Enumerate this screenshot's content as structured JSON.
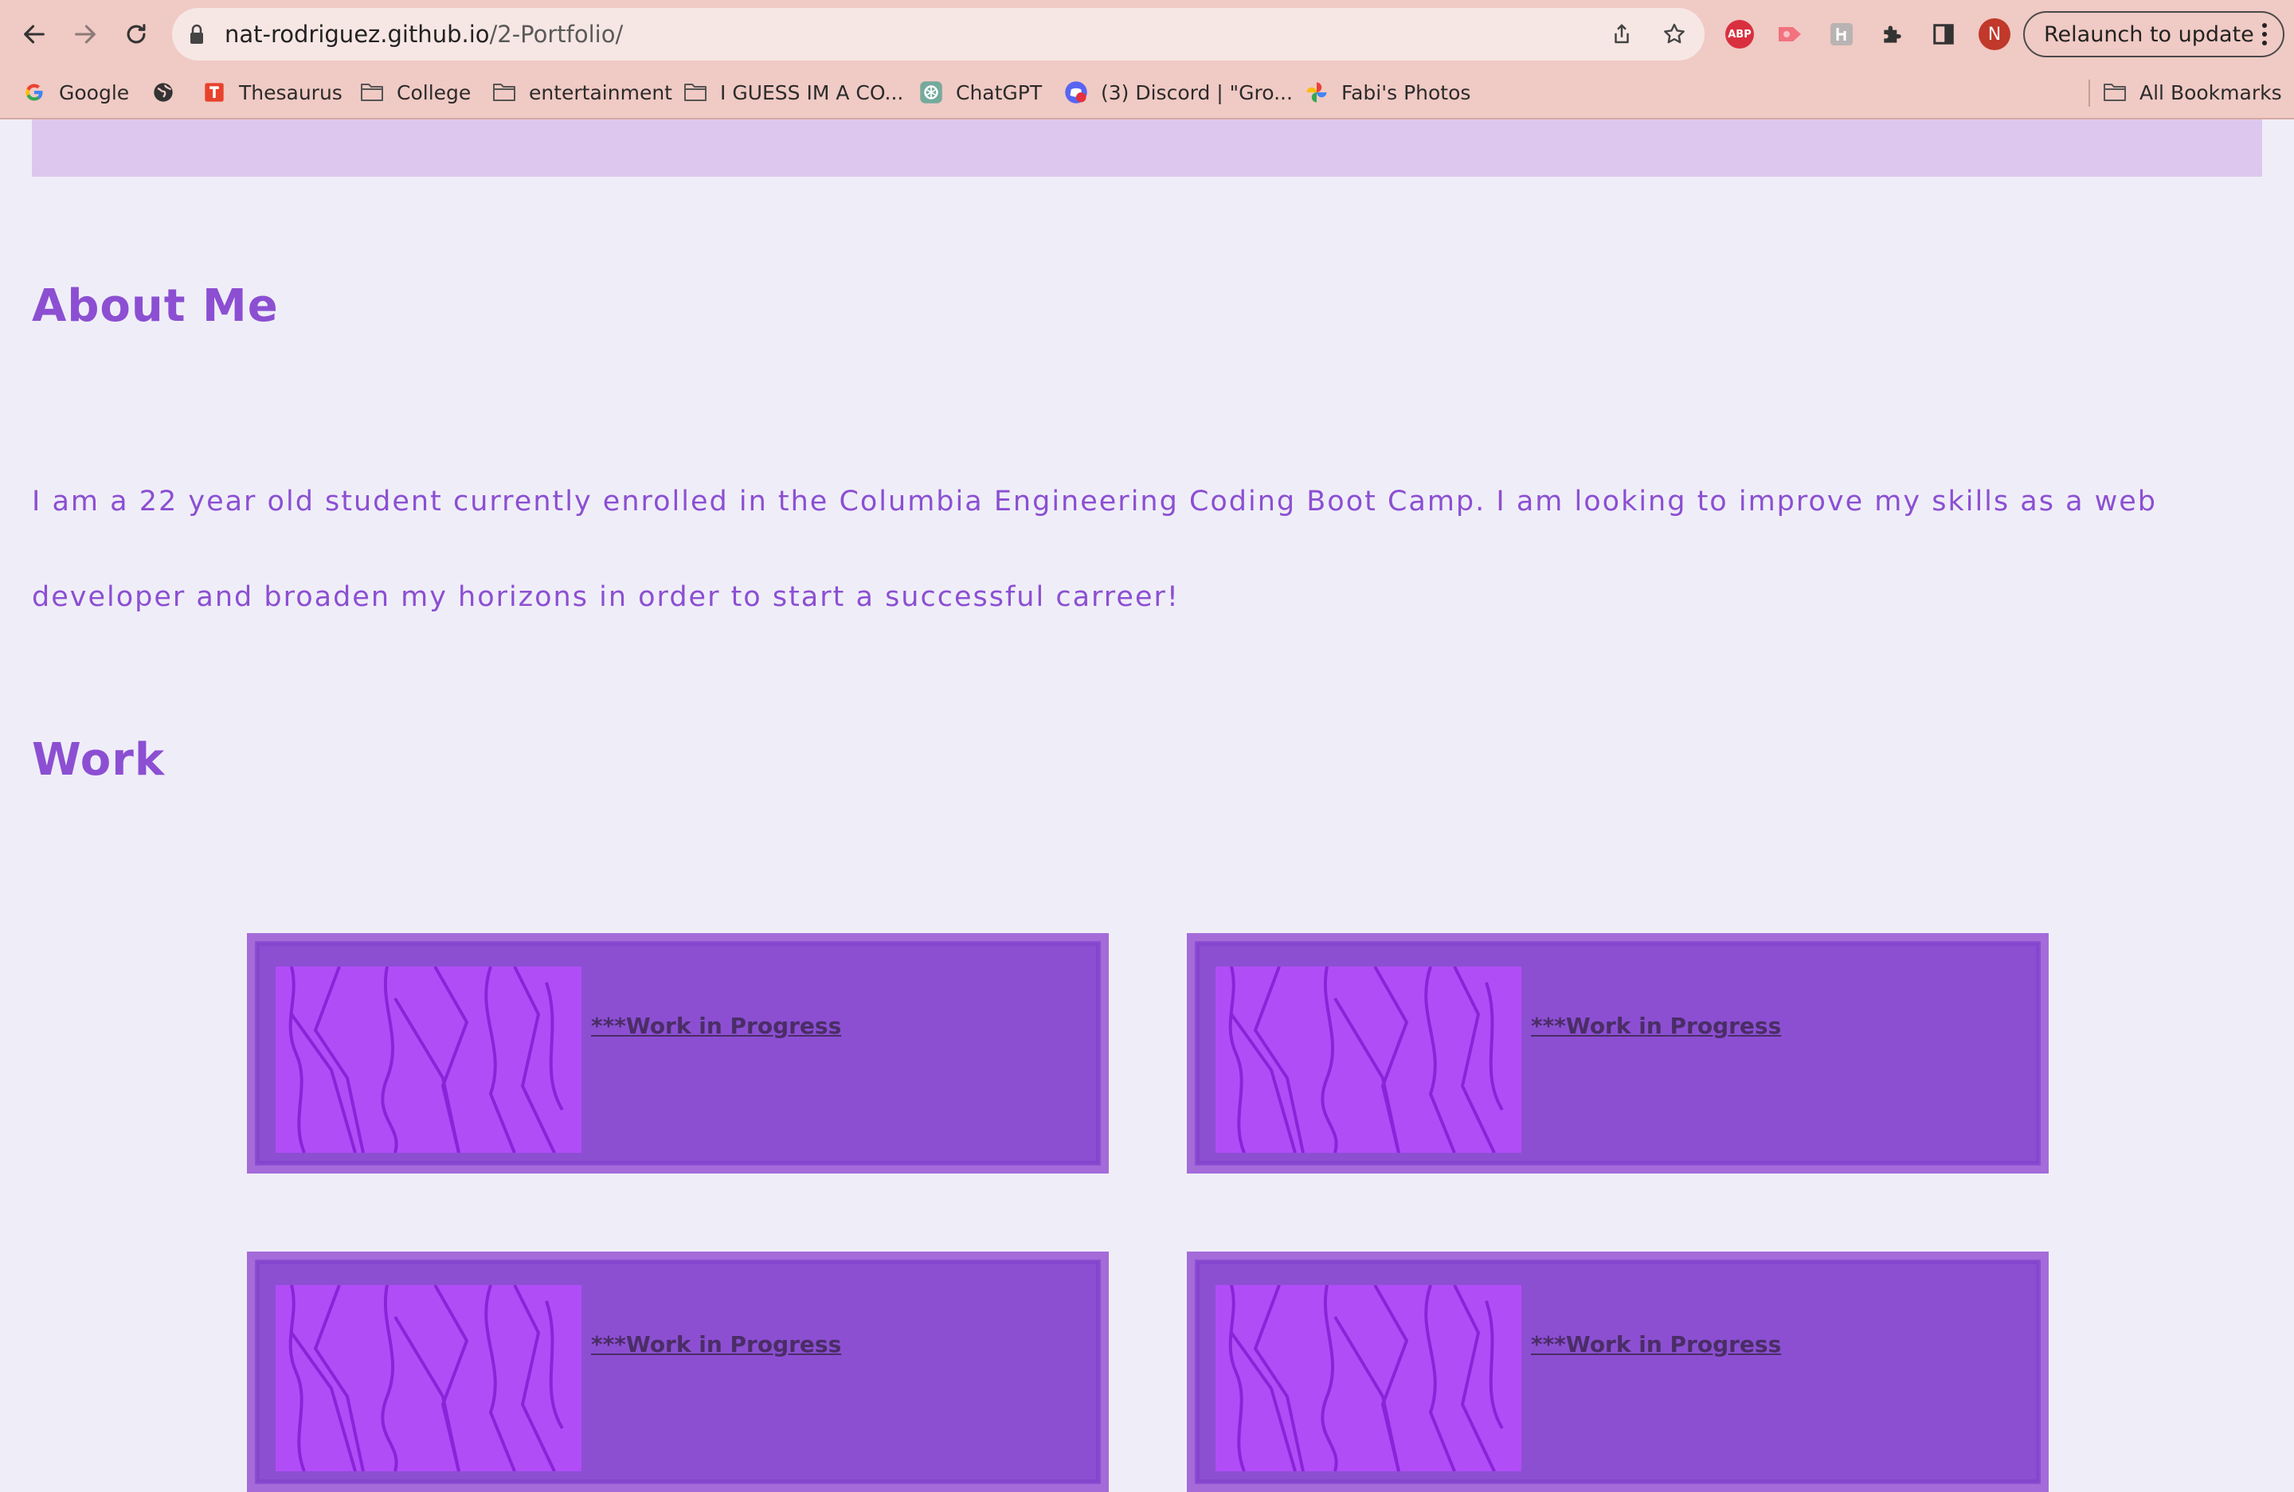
{
  "browser": {
    "url_host": "nat-rodriguez.github.io",
    "url_path": "/2-Portfolio/",
    "relaunch_label": "Relaunch to update",
    "avatar_letter": "N",
    "abp_label": "ABP",
    "bookmarks": [
      {
        "label": "Google",
        "icon": "google-icon"
      },
      {
        "label": "",
        "icon": "globe-icon"
      },
      {
        "label": "Thesaurus",
        "icon": "thesaurus-icon"
      },
      {
        "label": "College",
        "icon": "folder-icon"
      },
      {
        "label": "entertainment",
        "icon": "folder-icon"
      },
      {
        "label": "I GUESS IM A CO...",
        "icon": "folder-icon"
      },
      {
        "label": "ChatGPT",
        "icon": "chatgpt-icon"
      },
      {
        "label": "(3) Discord | \"Gro...",
        "icon": "discord-icon"
      },
      {
        "label": "Fabi's Photos",
        "icon": "photos-icon"
      }
    ],
    "all_bookmarks_label": "All Bookmarks"
  },
  "page": {
    "about_heading": "About Me",
    "about_text": "I am a 22 year old student currently enrolled in the Columbia Engineering Coding Boot Camp. I am looking to improve my skills as a web developer and broaden my horizons in order to start a successful carreer!",
    "work_heading": "Work",
    "work_items": [
      {
        "label": "***Work in Progress"
      },
      {
        "label": "***Work in Progress"
      },
      {
        "label": "***Work in Progress"
      },
      {
        "label": "***Work in Progress"
      }
    ]
  },
  "colors": {
    "chrome_bg": "#f0cac4",
    "page_bg": "#efeef8",
    "accent": "#8c4fd2",
    "card_border": "#a46bd9",
    "image_fill": "#b14df7",
    "header_strip": "#dec7ee"
  }
}
